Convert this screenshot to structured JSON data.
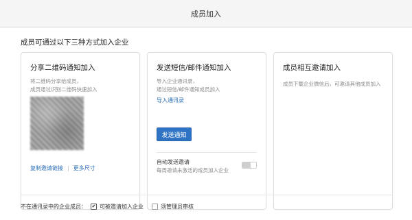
{
  "header": {
    "title": "成员加入"
  },
  "section": {
    "title": "成员可通过以下三种方式加入企业"
  },
  "cards": {
    "qr": {
      "title": "分享二维码通知加入",
      "desc_line1": "将二维码分享给成员，",
      "desc_line2": "成员通过识别二维码快速加入",
      "copy_link": "复制邀请链接",
      "separator": "|",
      "more_sizes": "更多尺寸"
    },
    "sms": {
      "title": "发送短信/邮件通知加入",
      "desc_line1": "导入企业通讯录，",
      "desc_line2": "通过短信/邮件通知成员加入",
      "import_link": "导入通讯录",
      "send_button": "发送通知",
      "auto_label": "自动发送邀请",
      "auto_desc": "每周邀请未激活的成员加入企业",
      "auto_enabled": false
    },
    "mutual": {
      "title": "成员相互邀请加入",
      "desc": "成员下载企业微信后，可邀请其他成员加入"
    }
  },
  "footer": {
    "label": "不在通讯录中的企业成员：",
    "option1": {
      "label": "可被邀请加入企业",
      "checked": true
    },
    "option2": {
      "label": "须管理员审核",
      "checked": false
    }
  },
  "colors": {
    "accent": "#2f74c4",
    "link": "#2a6fb8"
  }
}
